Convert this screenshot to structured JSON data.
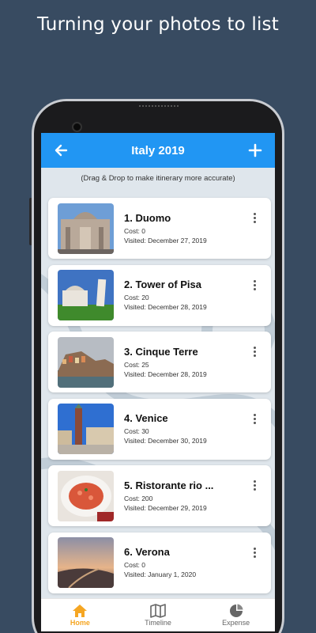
{
  "promo_text": "Turning your photos to list",
  "appbar": {
    "title": "Italy 2019",
    "back_icon": "arrow-left-icon",
    "add_icon": "plus-icon",
    "color": "#2196f3"
  },
  "hint": "(Drag & Drop to make itinerary more accurate)",
  "places": [
    {
      "name": "1. Duomo",
      "cost": "Cost: 0",
      "visited": "Visited: December 27, 2019"
    },
    {
      "name": "2. Tower of Pisa",
      "cost": "Cost: 20",
      "visited": "Visited: December 28, 2019"
    },
    {
      "name": "3. Cinque Terre",
      "cost": "Cost: 25",
      "visited": "Visited: December 28, 2019"
    },
    {
      "name": "4. Venice",
      "cost": "Cost: 30",
      "visited": "Visited: December 30, 2019"
    },
    {
      "name": "5. Ristorante rio ...",
      "cost": "Cost: 200",
      "visited": "Visited: December 29, 2019"
    },
    {
      "name": "6. Verona",
      "cost": "Cost: 0",
      "visited": "Visited: January 1, 2020"
    }
  ],
  "bottom_nav": [
    {
      "label": "Home",
      "icon": "home-icon",
      "active": true
    },
    {
      "label": "Timeline",
      "icon": "map-icon",
      "active": false
    },
    {
      "label": "Expense",
      "icon": "pie-chart-icon",
      "active": false
    }
  ],
  "colors": {
    "background": "#384b61",
    "accent": "#f5a623"
  }
}
